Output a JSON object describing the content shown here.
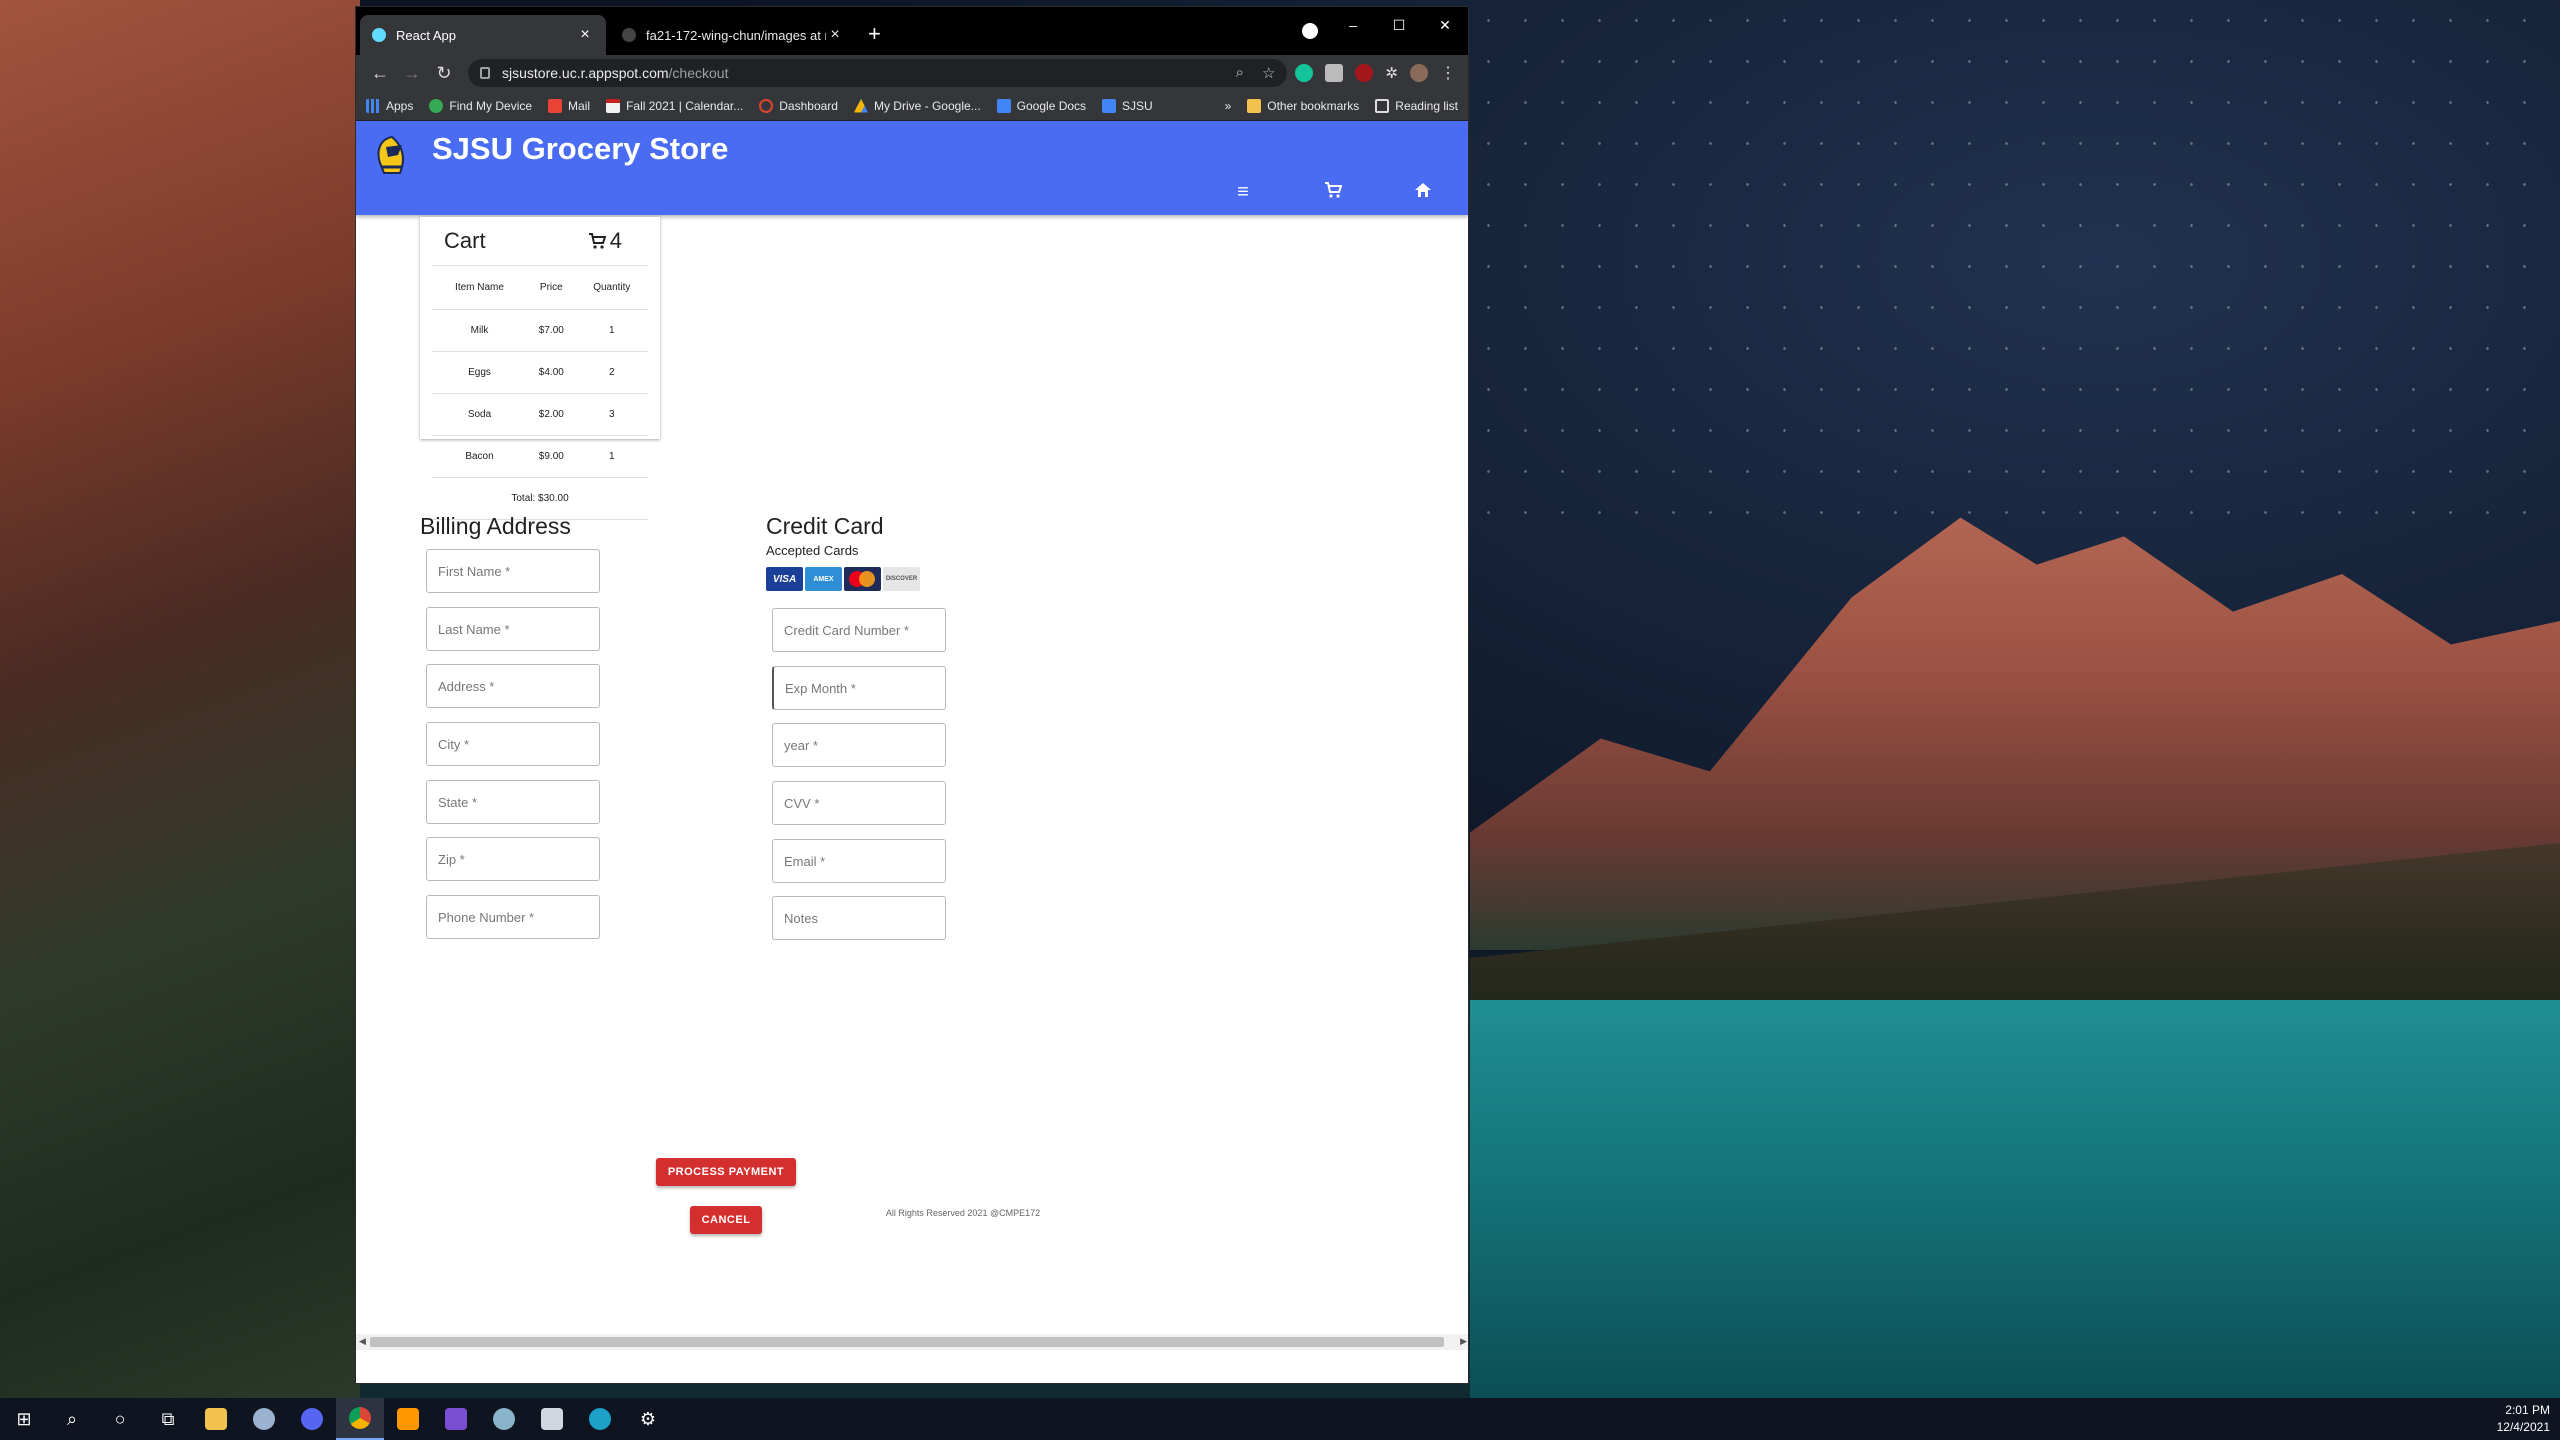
{
  "browser": {
    "tabs": [
      {
        "title": "React App",
        "active": true
      },
      {
        "title": "fa21-172-wing-chun/images at m",
        "active": false
      }
    ],
    "window_controls": {
      "minimize": "–",
      "maximize": "☐",
      "close": "✕"
    },
    "url_host": "sjsustore.uc.r.appspot.com",
    "url_path": "/checkout",
    "bookmarks": [
      "Apps",
      "Find My Device",
      "Mail",
      "Fall 2021 | Calendar...",
      "Dashboard",
      "My Drive - Google...",
      "Google Docs",
      "SJSU"
    ],
    "bookmarks_overflow": "»",
    "bookmarks_other": "Other bookmarks",
    "reading_list": "Reading list"
  },
  "app": {
    "title": "SJSU Grocery Store"
  },
  "cart": {
    "title": "Cart",
    "count": "4",
    "columns": [
      "Item Name",
      "Price",
      "Quantity"
    ],
    "rows": [
      {
        "name": "Milk",
        "price": "$7.00",
        "qty": "1"
      },
      {
        "name": "Eggs",
        "price": "$4.00",
        "qty": "2"
      },
      {
        "name": "Soda",
        "price": "$2.00",
        "qty": "3"
      },
      {
        "name": "Bacon",
        "price": "$9.00",
        "qty": "1"
      }
    ],
    "total": "Total: $30.00"
  },
  "billing": {
    "title": "Billing Address",
    "fields": [
      "First Name *",
      "Last Name *",
      "Address *",
      "City *",
      "State *",
      "Zip *",
      "Phone Number *"
    ]
  },
  "credit": {
    "title": "Credit Card",
    "accepted_label": "Accepted Cards",
    "cards": [
      "VISA",
      "AMEX",
      "",
      "DISCOVER"
    ],
    "fields": [
      "Credit Card Number *",
      "Exp Month *",
      "year *",
      "CVV *",
      "Email *",
      "Notes"
    ]
  },
  "actions": {
    "process": "PROCESS PAYMENT",
    "cancel": "CANCEL"
  },
  "footer": "All Rights Reserved 2021 @CMPE172",
  "clock": {
    "time": "2:01 PM",
    "date": "12/4/2021"
  },
  "colors": {
    "appbar": "#4a6cf2",
    "button": "#d32f2f"
  }
}
